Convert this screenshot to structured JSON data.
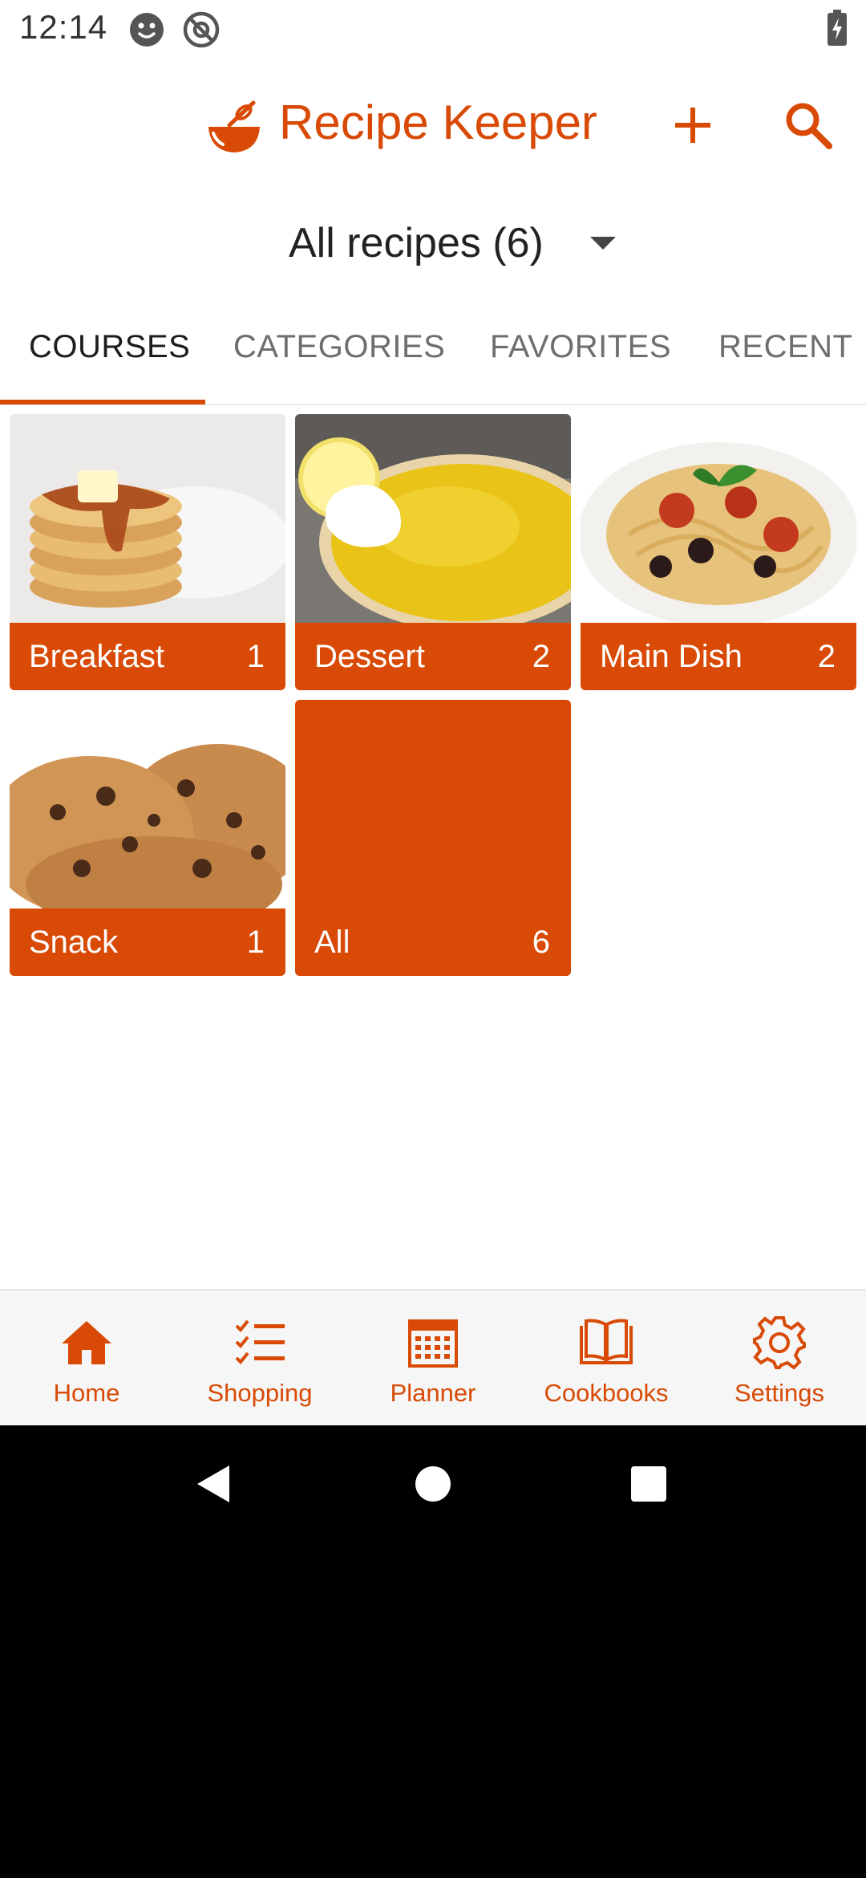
{
  "status_bar": {
    "time": "12:14",
    "icons": [
      "smiley-notification-icon",
      "at-sign-notification-icon",
      "battery-charging-icon"
    ]
  },
  "header": {
    "title": "Recipe Keeper",
    "logo_icon": "mixing-bowl-icon",
    "actions": [
      "plus-icon",
      "search-icon"
    ]
  },
  "filter": {
    "label": "All recipes (6)"
  },
  "tabs": [
    {
      "label": "COURSES",
      "active": true
    },
    {
      "label": "CATEGORIES",
      "active": false
    },
    {
      "label": "FAVORITES",
      "active": false
    },
    {
      "label": "RECENT",
      "active": false
    }
  ],
  "tiles": [
    {
      "label": "Breakfast",
      "count": "1",
      "image": "pancakes-photo"
    },
    {
      "label": "Dessert",
      "count": "2",
      "image": "lemon-tart-photo"
    },
    {
      "label": "Main Dish",
      "count": "2",
      "image": "spaghetti-photo"
    },
    {
      "label": "Snack",
      "count": "1",
      "image": "cookies-photo"
    },
    {
      "label": "All",
      "count": "6",
      "image": null
    }
  ],
  "bottom_nav": [
    {
      "label": "Home",
      "icon": "home-icon"
    },
    {
      "label": "Shopping",
      "icon": "checklist-icon"
    },
    {
      "label": "Planner",
      "icon": "calendar-icon"
    },
    {
      "label": "Cookbooks",
      "icon": "book-icon"
    },
    {
      "label": "Settings",
      "icon": "gear-icon"
    }
  ],
  "colors": {
    "accent": "#d84a05",
    "background": "#ffffff",
    "nav_background": "#f6f6f6"
  }
}
